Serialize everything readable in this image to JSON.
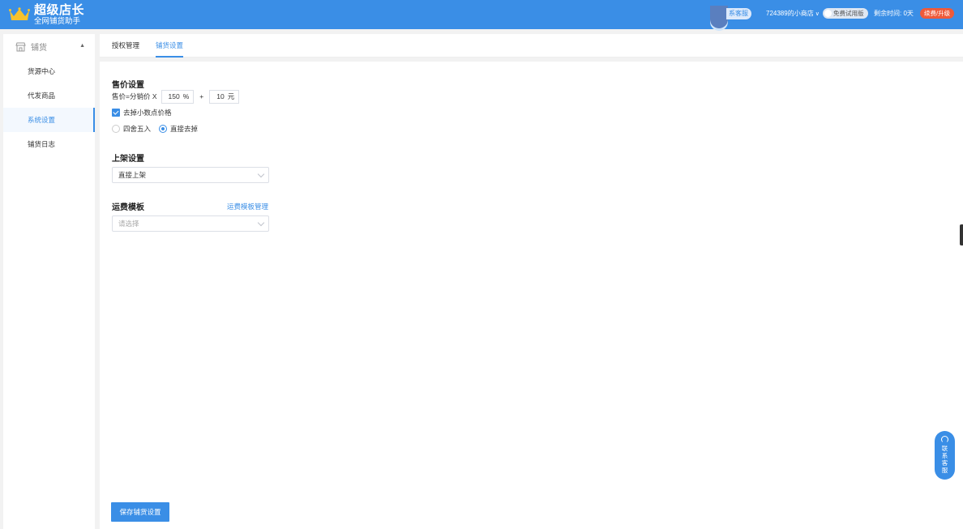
{
  "header": {
    "brand_title": "超级店长",
    "brand_subtitle": "全网铺货助手",
    "contact_label": "系客服",
    "shop_name": "724389的小商店",
    "trial_badge": "免费试用版",
    "remaining_label": "剩余时间: 0天",
    "upgrade_label": "续费/升级",
    "colors": {
      "primary": "#3a8ee6",
      "upgrade": "#ee5a3a"
    }
  },
  "sidebar": {
    "group_label": "铺货",
    "items": [
      {
        "label": "货源中心",
        "active": false
      },
      {
        "label": "代发商品",
        "active": false
      },
      {
        "label": "系统设置",
        "active": true
      },
      {
        "label": "铺货日志",
        "active": false
      }
    ]
  },
  "tabs": [
    {
      "label": "授权管理",
      "active": false
    },
    {
      "label": "铺货设置",
      "active": true
    }
  ],
  "price": {
    "title": "售价设置",
    "formula_label": "售价=分销价 X",
    "percent_value": "150",
    "percent_unit": "%",
    "plus": "+",
    "add_value": "10",
    "add_unit": "元",
    "remove_decimal_label": "去掉小数点价格",
    "remove_decimal_checked": true,
    "rounding_options": [
      {
        "label": "四舍五入",
        "selected": false
      },
      {
        "label": "直接去掉",
        "selected": true
      }
    ]
  },
  "listing": {
    "title": "上架设置",
    "selected": "直接上架"
  },
  "shipping": {
    "title": "运费模板",
    "manage_link": "运费模板管理",
    "placeholder": "请选择"
  },
  "save_button": "保存铺货设置",
  "float_service": {
    "chars": [
      "联",
      "系",
      "客",
      "服"
    ]
  },
  "icons": [
    "crown-icon",
    "store-icon",
    "chevron-up-icon",
    "chevron-down-icon",
    "checkmark-icon",
    "headset-icon"
  ]
}
